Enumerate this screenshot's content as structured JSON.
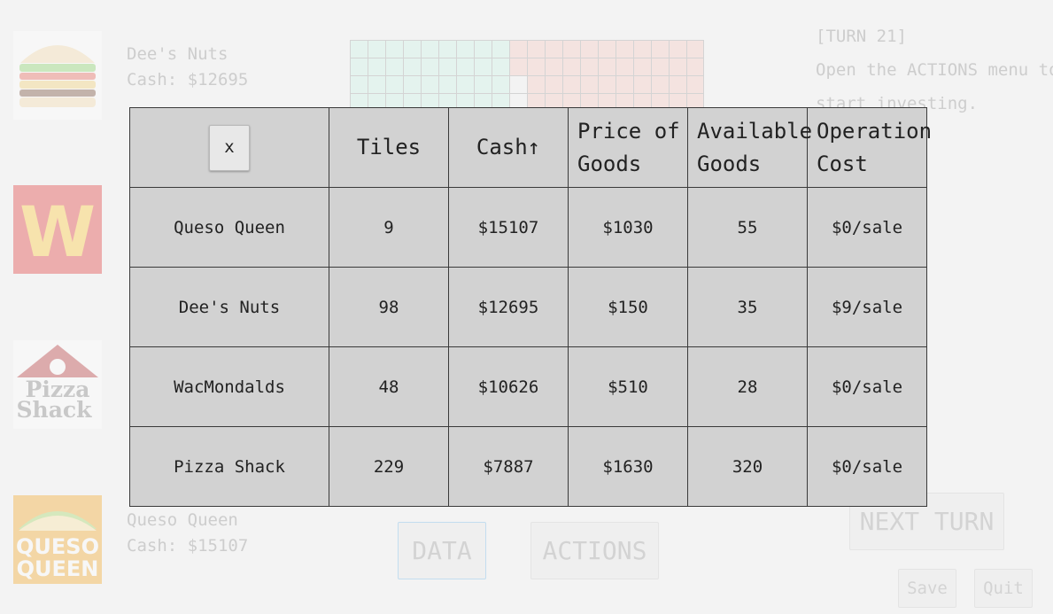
{
  "players": [
    {
      "name": "Dee's Nuts",
      "cash": "Cash: $12695",
      "logo": "burger-logo"
    },
    {
      "name": "Queso Queen",
      "cash": "Cash: $15107",
      "logo": "queso-queen-logo"
    }
  ],
  "logos": {
    "pizza_shack": [
      "Pizza",
      "Shack"
    ],
    "queso_queen": [
      "QUESO",
      "QUEEN"
    ],
    "wacmondalds": "W"
  },
  "turn": {
    "label": "[TURN 21]",
    "hint_line1": "Open the ACTIONS menu to",
    "hint_line2": "start investing."
  },
  "buttons": {
    "data": "DATA",
    "actions": "ACTIONS",
    "next_turn": "NEXT TURN",
    "save": "Save",
    "quit": "Quit",
    "close": "x"
  },
  "table": {
    "headers": {
      "tiles": "Tiles",
      "cash": "Cash↑",
      "price_l1": "Price of",
      "price_l2": "Goods",
      "available_l1": "Available",
      "available_l2": "Goods",
      "operation_l1": "Operation",
      "operation_l2": "Cost"
    },
    "rows": [
      {
        "name": "Queso Queen",
        "tiles": "9",
        "cash": "$15107",
        "price": "$1030",
        "available": "55",
        "cost": "$0/sale"
      },
      {
        "name": "Dee's Nuts",
        "tiles": "98",
        "cash": "$12695",
        "price": "$150",
        "available": "35",
        "cost": "$9/sale"
      },
      {
        "name": "WacMondalds",
        "tiles": "48",
        "cash": "$10626",
        "price": "$510",
        "available": "28",
        "cost": "$0/sale"
      },
      {
        "name": "Pizza Shack",
        "tiles": "229",
        "cash": "$7887",
        "price": "$1630",
        "available": "320",
        "cost": "$0/sale"
      }
    ]
  },
  "colors": {
    "territory_green": "#c9f3e6",
    "territory_red": "#f6c6bd",
    "modal_bg": "#d2d2d2",
    "active_border": "#6bb6e8"
  }
}
